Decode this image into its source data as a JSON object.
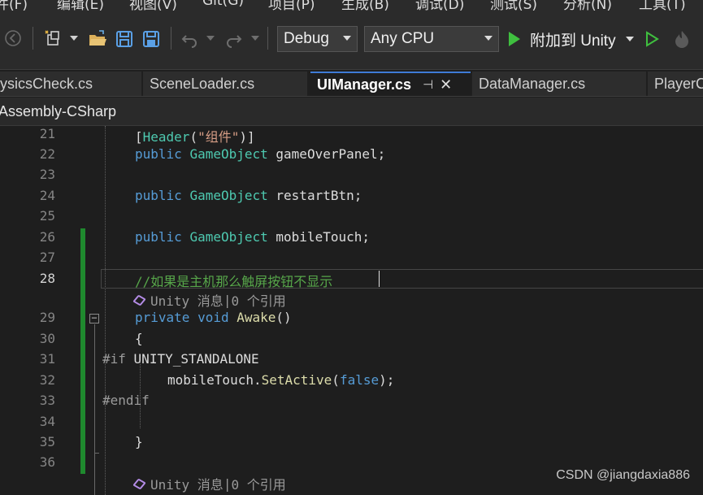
{
  "menu": {
    "items": [
      "件(F)",
      "编辑(E)",
      "视图(V)",
      "Git(G)",
      "项目(P)",
      "生成(B)",
      "调试(D)",
      "测试(S)",
      "分析(N)",
      "工具(T)"
    ]
  },
  "toolbar": {
    "configuration": "Debug",
    "platform": "Any CPU",
    "attach_label": "附加到 Unity",
    "icons": [
      "back-icon",
      "solution-icon",
      "open-folder-icon",
      "save-icon",
      "save-all-icon",
      "undo-icon",
      "redo-icon",
      "run-icon",
      "hot-reload-icon"
    ]
  },
  "tabs": [
    {
      "label": "ysicsCheck.cs",
      "active": false
    },
    {
      "label": "SceneLoader.cs",
      "active": false
    },
    {
      "label": "UIManager.cs",
      "active": true
    },
    {
      "label": "DataManager.cs",
      "active": false
    },
    {
      "label": "PlayerC",
      "active": false
    }
  ],
  "navbar": {
    "project": "Assembly-CSharp"
  },
  "editor": {
    "current_line": "28",
    "line_numbers": [
      "21",
      "22",
      "23",
      "24",
      "25",
      "26",
      "27",
      "28",
      "29",
      "30",
      "31",
      "32",
      "33",
      "34",
      "35",
      "36"
    ],
    "codelens": {
      "unity": "Unity 消息",
      "separator": "|",
      "refs": "0 个引用"
    },
    "code": {
      "l21_attr": "Header",
      "l21_str": "\"组件\"",
      "kw_public": "public",
      "kw_private": "private",
      "kw_void": "void",
      "kw_false": "false",
      "type_gameobject": "GameObject",
      "l22_name": "gameOverPanel;",
      "l24_name": "restartBtn;",
      "l26_name": "mobileTouch;",
      "l28_comment": "//如果是主机那么触屏按钮不显示",
      "l29_method": "Awake",
      "l29_parens": "()",
      "l30_brace": "{",
      "l31_if": "#if",
      "l31_symbol": "UNITY_STANDALONE",
      "l32_obj": "mobileTouch.",
      "l32_method": "SetActive",
      "l32_end": ");",
      "l33_endif": "#endif",
      "l35_brace": "}"
    }
  },
  "watermark": "CSDN @jiangdaxia886",
  "colors": {
    "keyword": "#569cd6",
    "type": "#4ec9b0",
    "method": "#dcdcaa",
    "comment": "#57a64a",
    "string": "#d69d85",
    "change_bar": "#1f8a2e",
    "active_tab_accent": "#3e7bd6"
  }
}
